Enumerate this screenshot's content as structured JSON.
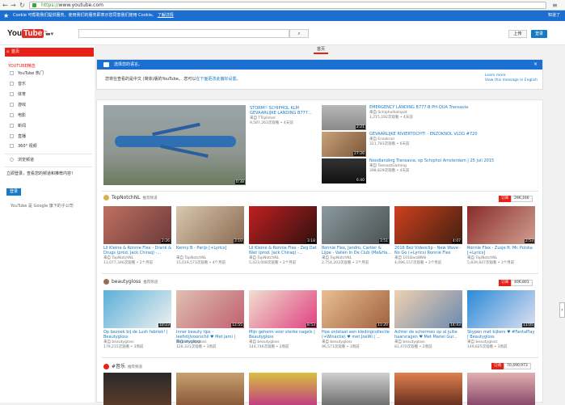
{
  "browser": {
    "url_scheme": "https://",
    "url_host": "www.youtube.com",
    "menu_glyph": "≡"
  },
  "cookie_bar": {
    "text": "Cookie 可帮助我们提供服务。使用我们的服务即表示您同意我们使用 Cookie。",
    "link": "了解详情",
    "ok": "知道了"
  },
  "masthead": {
    "logo_you": "You",
    "logo_tube": "Tube",
    "region": "NL",
    "upload": "上传",
    "signin": "登录"
  },
  "sidebar": {
    "home": "首页",
    "section": "YOUTUBE精选",
    "items": [
      "YouTube 热门",
      "音乐",
      "体育",
      "游戏",
      "电影",
      "新闻",
      "直播",
      "360° 视频"
    ],
    "browse": "浏览频道",
    "signin_text": "立即登录，查看您的频道和推荐内容！",
    "signin_btn": "登录",
    "google": "YouTube 是 Google 旗下的子公司"
  },
  "main": {
    "tab_home": "首页",
    "lang_header": "选择您的语言。",
    "lang_body_prefix": "您将在查看的是中文 (简体)版的YouTube。 您可以",
    "lang_body_link": "在下面更改此偏好设置",
    "lang_body_suffix": "。",
    "learn_more": "Learn more",
    "view_english": "View this message in English",
    "close": "×"
  },
  "featured": {
    "big": {
      "title": "STORM!! SCHIPHOL KLM GEVAARLIJKE LANDING B777...",
      "channel": "来自 TTsplimer",
      "meta": "9,587,263次观看 • 4天前",
      "duration": "0:38"
    },
    "side": [
      {
        "title": "EMERGENCY LANDING B777-B PH-QUA Transavia",
        "channel": "来自 Schipholhotspot",
        "meta": "1,215,192次观看 • 4天前",
        "duration": "2:21"
      },
      {
        "title": "GEVAARLIJKE RIVIERTOCHT! - ENZOKNOL VLOG #720",
        "channel": "来自 Enzoknol",
        "meta": "321,783次观看 • 6天前",
        "duration": "27:26"
      },
      {
        "title": "Noodlanding Transavia, op Schiphol Amsterdam | 25 juli 2015",
        "channel": "来自 ToenozzGaming",
        "meta": "398,829次观看 • 4天前",
        "duration": "6:40"
      }
    ]
  },
  "shelves": [
    {
      "name": "TopNotchNL",
      "rec": "推荐频道",
      "sub": "订阅",
      "count": "296,166",
      "videos": [
        {
          "title": "Lil Kleine & Ronnie Flex - Drank & Drugs (prod. Jack Chiraq) -...",
          "channel": "来自 TopNotchNL",
          "meta": "13,077,346次观看 • 2个月前",
          "duration": "2:26"
        },
        {
          "title": "Kenny B - Parijs [+Lyrics]",
          "channel": "来自 TopNotchNL",
          "meta": "15,019,573次观看 • 4个月前",
          "duration": "3:10"
        },
        {
          "title": "Lil Kleine & Ronnie Flex - Zeg Dat Niet (prod. Jack Chiraq) -...",
          "channel": "来自 TopNotchNL",
          "meta": "5,423,008次观看 • 2个月前",
          "duration": "3:18"
        },
        {
          "title": "Ronnie Flex, Jandro, Cartier & Lijpe - Vallen In De Club (Me&Ha...",
          "channel": "来自 TopNotchNL",
          "meta": "2,754,203次观看 • 3个月前",
          "duration": "3:51"
        },
        {
          "title": "2016 Bez Videoclip - New Wave - No Go (+Lyrics) Ronnie Flex",
          "channel": "来自 101BarzBNN",
          "meta": "4,096,157次观看 • 3个月前",
          "duration": "4:07"
        },
        {
          "title": "Ronnie Flex - Zusje ft. Mr. Polska [+Lyrics]",
          "channel": "来自 TopNotchNL",
          "meta": "5,839,647次观看 • 3个月前",
          "duration": "2:53"
        }
      ]
    },
    {
      "name": "beautygloss",
      "rec": "推荐频道",
      "sub": "订阅",
      "count": "406,801",
      "videos": [
        {
          "title": "Op bezoek bij de Lush fabriek! | Beautygloss",
          "channel": "来自 beautygloss",
          "meta": "179,215次观看 • 3周前",
          "duration": "10:23"
        },
        {
          "title": "Inner beauty tips - leefstijlvoorschil ♥ Met Jami | Beautygloss",
          "channel": "来自 beautygloss",
          "meta": "126,331次观看 • 3周前",
          "duration": "12:55"
        },
        {
          "title": "Mijn geheim voor sterke nagels | Beautygloss",
          "channel": "来自 beautygloss",
          "meta": "144,746次观看 • 2周前",
          "duration": "8:53"
        },
        {
          "title": "Hoe ontstaat een kledingcollectie (+Winactie) ♥ met JoeWi | ...",
          "channel": "来自 beautygloss",
          "meta": "96,571次观看 • 3周前",
          "duration": "11:20"
        },
        {
          "title": "Achter de schermen op al jullie haarvragen ♥ Met Mariel Gur...",
          "channel": "来自 beautygloss",
          "meta": "81,470次观看 • 2周前",
          "duration": "14:43"
        },
        {
          "title": "Skypen met kijkers ♥ #FantaPlay | Beautygloss",
          "channel": "来自 beautygloss",
          "meta": "149,825次观看 • 3周前",
          "duration": "11:05"
        }
      ]
    },
    {
      "name": "#音乐",
      "rec": "推荐频道",
      "sub": "订阅",
      "count": "70,490,973",
      "videos": []
    }
  ],
  "colors": {
    "accent": "#e62117",
    "blue": "#1a6fd1",
    "link": "#167ac6"
  }
}
